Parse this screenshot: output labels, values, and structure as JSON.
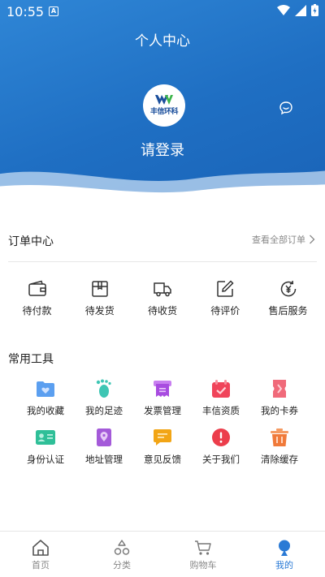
{
  "status_bar": {
    "time": "10:55",
    "notification_badge": "A"
  },
  "header": {
    "title": "个人中心",
    "login_text": "请登录",
    "logo_text": "丰信环科"
  },
  "orders": {
    "title": "订单中心",
    "view_all": "查看全部订单",
    "items": [
      {
        "label": "待付款",
        "icon": "wallet-icon"
      },
      {
        "label": "待发货",
        "icon": "package-icon"
      },
      {
        "label": "待收货",
        "icon": "truck-icon"
      },
      {
        "label": "待评价",
        "icon": "edit-icon"
      },
      {
        "label": "售后服务",
        "icon": "yen-refund-icon"
      }
    ]
  },
  "tools": {
    "title": "常用工具",
    "items": [
      {
        "label": "我的收藏",
        "icon": "folder-heart-icon",
        "color": "#5b9ff0"
      },
      {
        "label": "我的足迹",
        "icon": "footprint-icon",
        "color": "#3ec6b4"
      },
      {
        "label": "发票管理",
        "icon": "invoice-icon",
        "color": "#b35be8"
      },
      {
        "label": "丰信资质",
        "icon": "calendar-check-icon",
        "color": "#f0445a"
      },
      {
        "label": "我的卡券",
        "icon": "ticket-icon",
        "color": "#f06a7a"
      },
      {
        "label": "身份认证",
        "icon": "id-card-icon",
        "color": "#2fbf98"
      },
      {
        "label": "地址管理",
        "icon": "location-book-icon",
        "color": "#a45ad9"
      },
      {
        "label": "意见反馈",
        "icon": "chat-icon",
        "color": "#f2a515"
      },
      {
        "label": "关于我们",
        "icon": "info-circle-icon",
        "color": "#ec3d4b"
      },
      {
        "label": "清除缓存",
        "icon": "trash-icon",
        "color": "#f07a3a"
      }
    ]
  },
  "bottom_nav": {
    "items": [
      {
        "label": "首页",
        "icon": "home-icon",
        "active": false
      },
      {
        "label": "分类",
        "icon": "category-icon",
        "active": false
      },
      {
        "label": "购物车",
        "icon": "cart-icon",
        "active": false
      },
      {
        "label": "我的",
        "icon": "profile-icon",
        "active": true
      }
    ]
  },
  "colors": {
    "header_blue": "#1f6fc3",
    "accent": "#2a7ad5"
  }
}
